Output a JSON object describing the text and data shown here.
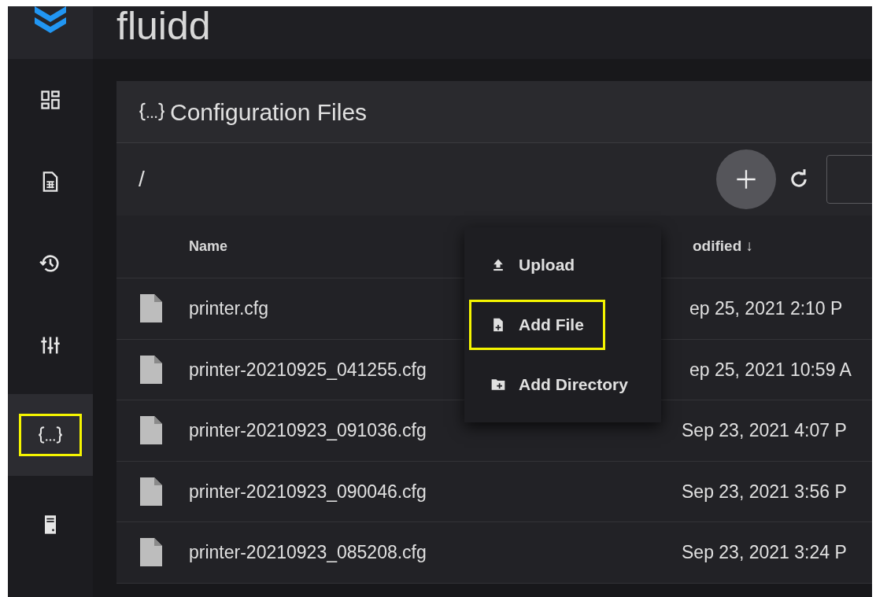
{
  "app": {
    "title": "fluidd"
  },
  "sidebar": {
    "items": [
      {
        "kind": "dashboard",
        "selected": false,
        "highlighted": false
      },
      {
        "kind": "jobs",
        "selected": false,
        "highlighted": false
      },
      {
        "kind": "history",
        "selected": false,
        "highlighted": false
      },
      {
        "kind": "tune",
        "selected": false,
        "highlighted": false
      },
      {
        "kind": "configuration",
        "selected": true,
        "highlighted": true
      },
      {
        "kind": "system",
        "selected": false,
        "highlighted": false
      }
    ]
  },
  "card": {
    "title": "Configuration Files",
    "path": "/"
  },
  "table": {
    "columns": [
      "Name",
      "odified ↓"
    ],
    "rows": [
      {
        "name": "printer.cfg",
        "modified": "ep 25, 2021 2:10 P"
      },
      {
        "name": "printer-20210925_041255.cfg",
        "modified": "ep 25, 2021 10:59 A"
      },
      {
        "name": "printer-20210923_091036.cfg",
        "modified": "Sep 23, 2021 4:07 P"
      },
      {
        "name": "printer-20210923_090046.cfg",
        "modified": "Sep 23, 2021 3:56 P"
      },
      {
        "name": "printer-20210923_085208.cfg",
        "modified": "Sep 23, 2021 3:24 P"
      }
    ]
  },
  "add_menu": {
    "items": [
      {
        "kind": "upload",
        "label": "Upload",
        "highlighted": false
      },
      {
        "kind": "file",
        "label": "Add File",
        "highlighted": true
      },
      {
        "kind": "directory",
        "label": "Add Directory",
        "highlighted": false
      }
    ]
  }
}
